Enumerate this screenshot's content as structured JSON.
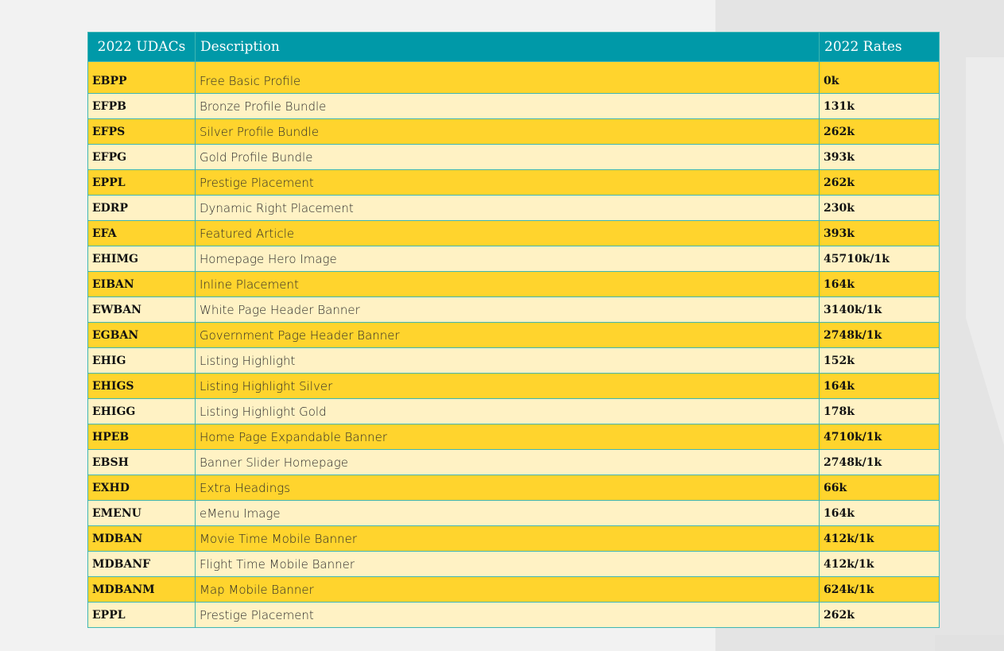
{
  "table": {
    "headers": {
      "code": "2022 UDACs",
      "description": "Description",
      "rate": "2022 Rates"
    },
    "rows": [
      {
        "code": "EBPP",
        "description": "Free Basic Profile",
        "rate": "0k"
      },
      {
        "code": "EFPB",
        "description": "Bronze Profile Bundle",
        "rate": "131k"
      },
      {
        "code": "EFPS",
        "description": "Silver Profile Bundle",
        "rate": "262k"
      },
      {
        "code": "EFPG",
        "description": "Gold Profile Bundle",
        "rate": "393k"
      },
      {
        "code": "EPPL",
        "description": "Prestige Placement",
        "rate": "262k"
      },
      {
        "code": "EDRP",
        "description": "Dynamic Right Placement",
        "rate": "230k"
      },
      {
        "code": "EFA",
        "description": "Featured Article",
        "rate": "393k"
      },
      {
        "code": "EHIMG",
        "description": "Homepage Hero Image",
        "rate": "45710k/1k"
      },
      {
        "code": "EIBAN",
        "description": "Inline Placement",
        "rate": "164k"
      },
      {
        "code": "EWBAN",
        "description": "White Page Header Banner",
        "rate": "3140k/1k"
      },
      {
        "code": "EGBAN",
        "description": "Government Page Header Banner",
        "rate": "2748k/1k"
      },
      {
        "code": "EHIG",
        "description": "Listing Highlight",
        "rate": "152k"
      },
      {
        "code": "EHIGS",
        "description": "Listing Highlight Silver",
        "rate": "164k"
      },
      {
        "code": "EHIGG",
        "description": "Listing Highlight Gold",
        "rate": "178k"
      },
      {
        "code": "HPEB",
        "description": "Home Page Expandable Banner",
        "rate": "4710k/1k"
      },
      {
        "code": "EBSH",
        "description": "Banner Slider Homepage",
        "rate": "2748k/1k"
      },
      {
        "code": "EXHD",
        "description": "Extra Headings",
        "rate": "66k"
      },
      {
        "code": "EMENU",
        "description": "eMenu Image",
        "rate": "164k"
      },
      {
        "code": "MDBAN",
        "description": "Movie Time Mobile Banner",
        "rate": "412k/1k"
      },
      {
        "code": "MDBANF",
        "description": "Flight Time Mobile Banner",
        "rate": "412k/1k"
      },
      {
        "code": "MDBANM",
        "description": "Map Mobile Banner",
        "rate": "624k/1k"
      },
      {
        "code": "EPPL",
        "description": "Prestige Placement",
        "rate": "262k"
      }
    ]
  },
  "colors": {
    "header_bg": "#0099a8",
    "row_odd": "#ffd42d",
    "row_even": "#fff2c4",
    "border": "#3fb6b3"
  }
}
